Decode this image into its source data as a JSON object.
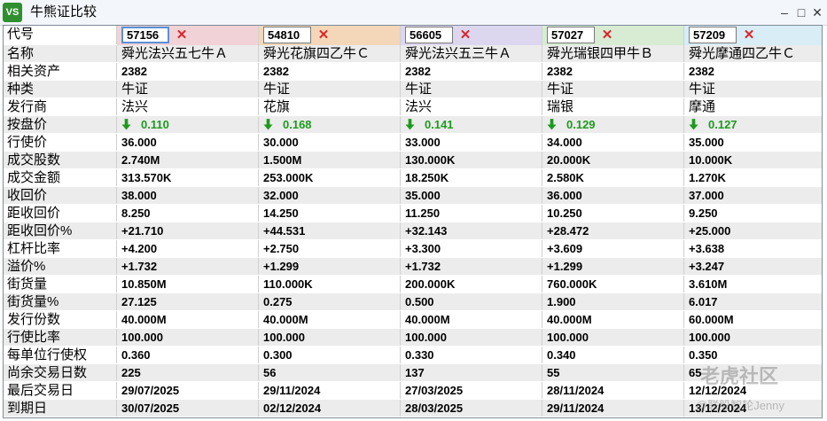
{
  "window": {
    "title": "牛熊证比较",
    "app_icon_text": "VS"
  },
  "columns": [
    {
      "code": "57156",
      "color": "#f1d2d6",
      "active": true
    },
    {
      "code": "54810",
      "color": "#f3d7b8"
    },
    {
      "code": "56605",
      "color": "#dcd6ef"
    },
    {
      "code": "57027",
      "color": "#d7ecd3"
    },
    {
      "code": "57209",
      "color": "#d8edf6"
    }
  ],
  "header_label": "代号",
  "rows": [
    {
      "label": "名称",
      "style": "txt",
      "values": [
        "舜光法兴五七牛Ａ",
        "舜光花旗四乙牛Ｃ",
        "舜光法兴五三牛Ａ",
        "舜光瑞银四甲牛Ｂ",
        "舜光摩通四乙牛Ｃ"
      ]
    },
    {
      "label": "相关资产",
      "values": [
        "2382",
        "2382",
        "2382",
        "2382",
        "2382"
      ]
    },
    {
      "label": "种类",
      "style": "txt",
      "values": [
        "牛证",
        "牛证",
        "牛证",
        "牛证",
        "牛证"
      ]
    },
    {
      "label": "发行商",
      "style": "txt",
      "values": [
        "法兴",
        "花旗",
        "法兴",
        "瑞银",
        "摩通"
      ]
    },
    {
      "label": "按盘价",
      "style": "price",
      "values": [
        "0.110",
        "0.168",
        "0.141",
        "0.129",
        "0.127"
      ]
    },
    {
      "label": "行使价",
      "values": [
        "36.000",
        "30.000",
        "33.000",
        "34.000",
        "35.000"
      ]
    },
    {
      "label": "成交股数",
      "values": [
        "2.740M",
        "1.500M",
        "130.000K",
        "20.000K",
        "10.000K"
      ]
    },
    {
      "label": "成交金额",
      "values": [
        "313.570K",
        "253.000K",
        "18.250K",
        "2.580K",
        "1.270K"
      ]
    },
    {
      "label": "收回价",
      "values": [
        "38.000",
        "32.000",
        "35.000",
        "36.000",
        "37.000"
      ]
    },
    {
      "label": "距收回价",
      "values": [
        "8.250",
        "14.250",
        "11.250",
        "10.250",
        "9.250"
      ],
      "badges": [
        1
      ]
    },
    {
      "label": "距收回价%",
      "values": [
        "+21.710",
        "+44.531",
        "+32.143",
        "+28.472",
        "+25.000"
      ],
      "badges": [
        1
      ]
    },
    {
      "label": "杠杆比率",
      "values": [
        "+4.200",
        "+2.750",
        "+3.300",
        "+3.609",
        "+3.638"
      ],
      "badges": [
        0
      ]
    },
    {
      "label": "溢价%",
      "values": [
        "+1.732",
        "+1.299",
        "+1.732",
        "+1.299",
        "+3.247"
      ],
      "badges": [
        1,
        3
      ]
    },
    {
      "label": "街货量",
      "values": [
        "10.850M",
        "110.000K",
        "200.000K",
        "760.000K",
        "3.610M"
      ],
      "badges": [
        1
      ]
    },
    {
      "label": "街货量%",
      "values": [
        "27.125",
        "0.275",
        "0.500",
        "1.900",
        "6.017"
      ],
      "badges": [
        1
      ]
    },
    {
      "label": "发行份数",
      "values": [
        "40.000M",
        "40.000M",
        "40.000M",
        "40.000M",
        "60.000M"
      ]
    },
    {
      "label": "行使比率",
      "values": [
        "100.000",
        "100.000",
        "100.000",
        "100.000",
        "100.000"
      ]
    },
    {
      "label": "每单位行使权",
      "values": [
        "0.360",
        "0.300",
        "0.330",
        "0.340",
        "0.350"
      ]
    },
    {
      "label": "尚余交易日数",
      "values": [
        "225",
        "56",
        "137",
        "55",
        "65"
      ],
      "badges": [
        0
      ]
    },
    {
      "label": "最后交易日",
      "values": [
        "29/07/2025",
        "29/11/2024",
        "27/03/2025",
        "28/11/2024",
        "12/12/2024"
      ],
      "badges": [
        0
      ]
    },
    {
      "label": "到期日",
      "values": [
        "30/07/2025",
        "02/12/2024",
        "28/03/2025",
        "29/11/2024",
        "13/12/2024"
      ],
      "badges": [
        0
      ]
    }
  ],
  "watermark": {
    "brand": "老虎社区",
    "user": "@联股智轮Jenny"
  }
}
